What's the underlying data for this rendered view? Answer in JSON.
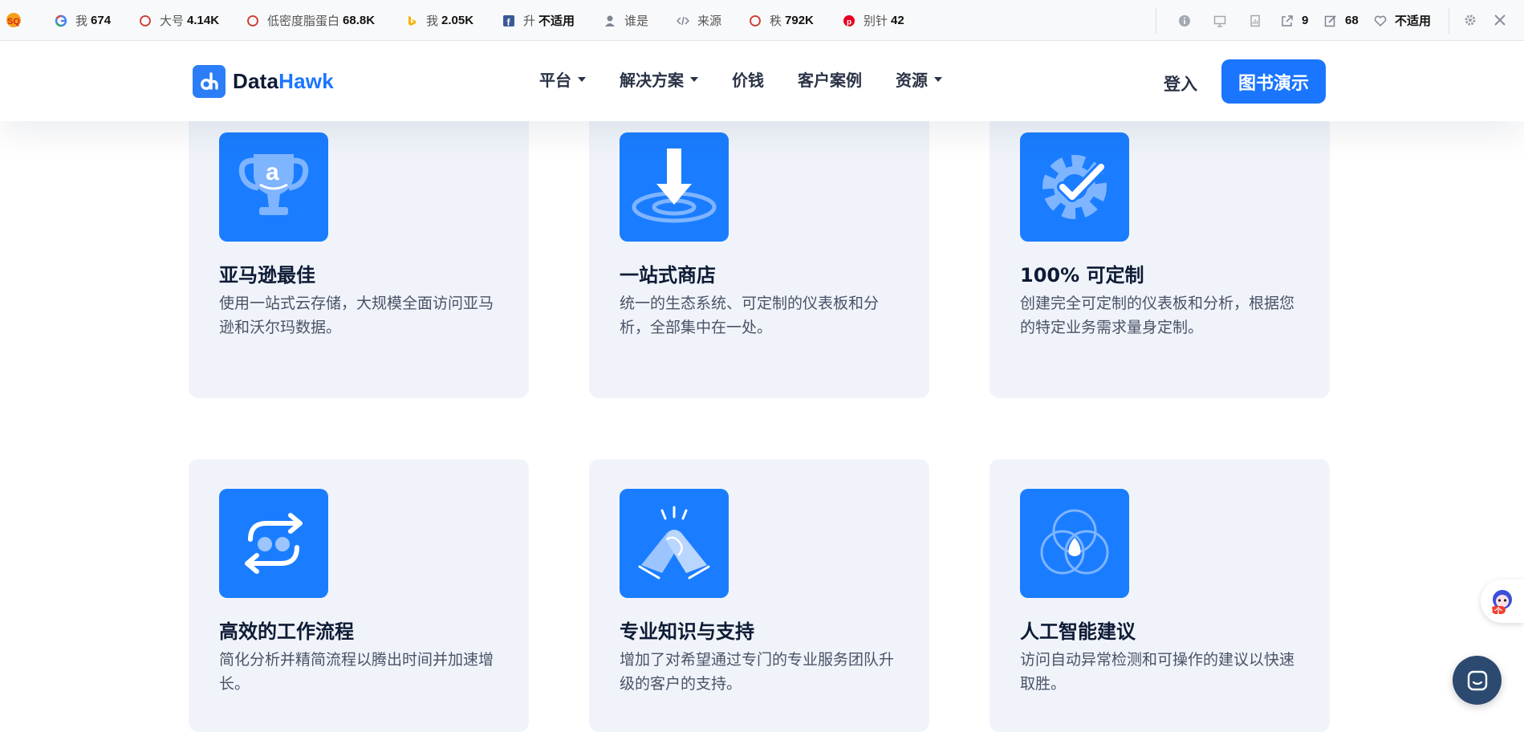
{
  "seo_toolbar": {
    "items": [
      {
        "label": "我",
        "value": "674",
        "icon": "google-icon"
      },
      {
        "label": "大号",
        "value": "4.14K",
        "icon": "circle-icon"
      },
      {
        "label": "低密度脂蛋白",
        "value": "68.8K",
        "icon": "circle-icon"
      },
      {
        "label": "我",
        "value": "2.05K",
        "icon": "bing-icon"
      },
      {
        "label": "升",
        "value": "不适用",
        "icon": "facebook-icon"
      },
      {
        "label": "谁是",
        "value": "",
        "icon": "user-icon"
      },
      {
        "label": "来源",
        "value": "",
        "icon": "code-icon"
      },
      {
        "label": "秩",
        "value": "792K",
        "icon": "circle-icon"
      },
      {
        "label": "别针",
        "value": "42",
        "icon": "pinterest-icon"
      }
    ],
    "right_items": [
      {
        "value": "",
        "icon": "info-icon"
      },
      {
        "value": "",
        "icon": "monitor-icon"
      },
      {
        "value": "",
        "icon": "page-icon"
      },
      {
        "value": "9",
        "icon": "external-link-icon"
      },
      {
        "value": "68",
        "icon": "edit-icon"
      },
      {
        "value": "不适用",
        "icon": "heart-icon"
      }
    ]
  },
  "header": {
    "brand_main": "Data",
    "brand_accent": "Hawk",
    "nav": [
      {
        "label": "平台",
        "has_dropdown": true
      },
      {
        "label": "解决方案",
        "has_dropdown": true
      },
      {
        "label": "价钱",
        "has_dropdown": false
      },
      {
        "label": "客户案例",
        "has_dropdown": false
      },
      {
        "label": "资源",
        "has_dropdown": true
      }
    ],
    "login_label": "登入",
    "demo_label": "图书演示"
  },
  "features": [
    {
      "title": "亚马逊最佳",
      "desc": "使用一站式云存储，大规模全面访问亚马逊和沃尔玛数据。",
      "icon": "amazon-trophy-icon"
    },
    {
      "title": "一站式商店",
      "desc": "统一的生态系统、可定制的仪表板和分析，全部集中在一处。",
      "icon": "download-target-icon"
    },
    {
      "title": "100% 可定制",
      "desc": "创建完全可定制的仪表板和分析，根据您的特定业务需求量身定制。",
      "icon": "gear-check-icon"
    },
    {
      "title": "高效的工作流程",
      "desc": "简化分析并精简流程以腾出时间并加速增长。",
      "icon": "workflow-cycle-icon"
    },
    {
      "title": "专业知识与支持",
      "desc": "增加了对希望通过专门的专业服务团队升级的客户的支持。",
      "icon": "handshake-icon"
    },
    {
      "title": "人工智能建议",
      "desc": "访问自动异常检测和可操作的建议以快速取胜。",
      "icon": "venn-ai-icon"
    }
  ],
  "widgets": {
    "side_badge": "1个"
  },
  "colors": {
    "accent": "#1a75ff",
    "card_bg": "#f0f4fa",
    "heading": "#0e1b35"
  }
}
